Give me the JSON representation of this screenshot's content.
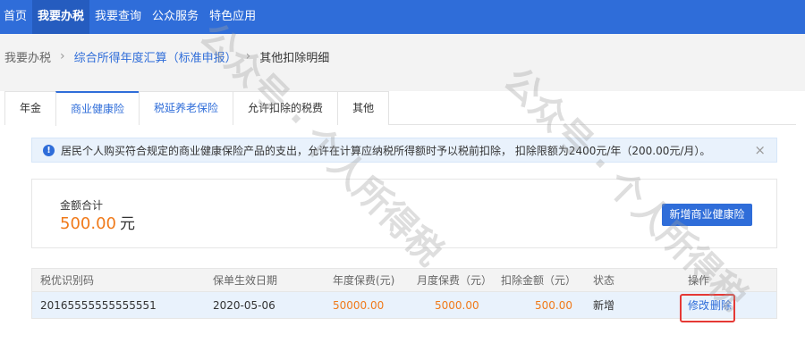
{
  "topnav": {
    "items": [
      {
        "label": "首页",
        "active": false
      },
      {
        "label": "我要办税",
        "active": true
      },
      {
        "label": "我要查询",
        "active": false
      },
      {
        "label": "公众服务",
        "active": false
      },
      {
        "label": "特色应用",
        "active": false
      }
    ]
  },
  "breadcrumb": {
    "items": [
      "我要办税",
      "综合所得年度汇算（标准申报）",
      "其他扣除明细"
    ],
    "separator": "›"
  },
  "tabs": [
    "年金",
    "商业健康险",
    "税延养老保险",
    "允许扣除的税费",
    "其他"
  ],
  "notice": {
    "icon": "info-icon",
    "text": "居民个人购买符合规定的商业健康保险产品的支出，允许在计算应纳税所得额时予以税前扣除， 扣除限额为2400元/年（200.00元/月）。",
    "close": "×"
  },
  "summary": {
    "label": "金额合计",
    "amount": "500.00",
    "unit": "元",
    "add_button": "新增商业健康险"
  },
  "table": {
    "headers": [
      "税优识别码",
      "保单生效日期",
      "年度保费(元)",
      "月度保费（元）",
      "扣除金额（元）",
      "状态",
      "操作"
    ],
    "rows": [
      {
        "code": "20165555555555551",
        "date": "2020-05-06",
        "annual": "50000.00",
        "monthly": "5000.00",
        "deduct": "500.00",
        "status": "新增",
        "edit": "修改",
        "delete": "删除"
      }
    ]
  },
  "watermark": "公众号 · 个人所得税",
  "colors": {
    "brand": "#2f6dd9",
    "amount": "#f07a1a",
    "highlight_border": "#e53935"
  }
}
